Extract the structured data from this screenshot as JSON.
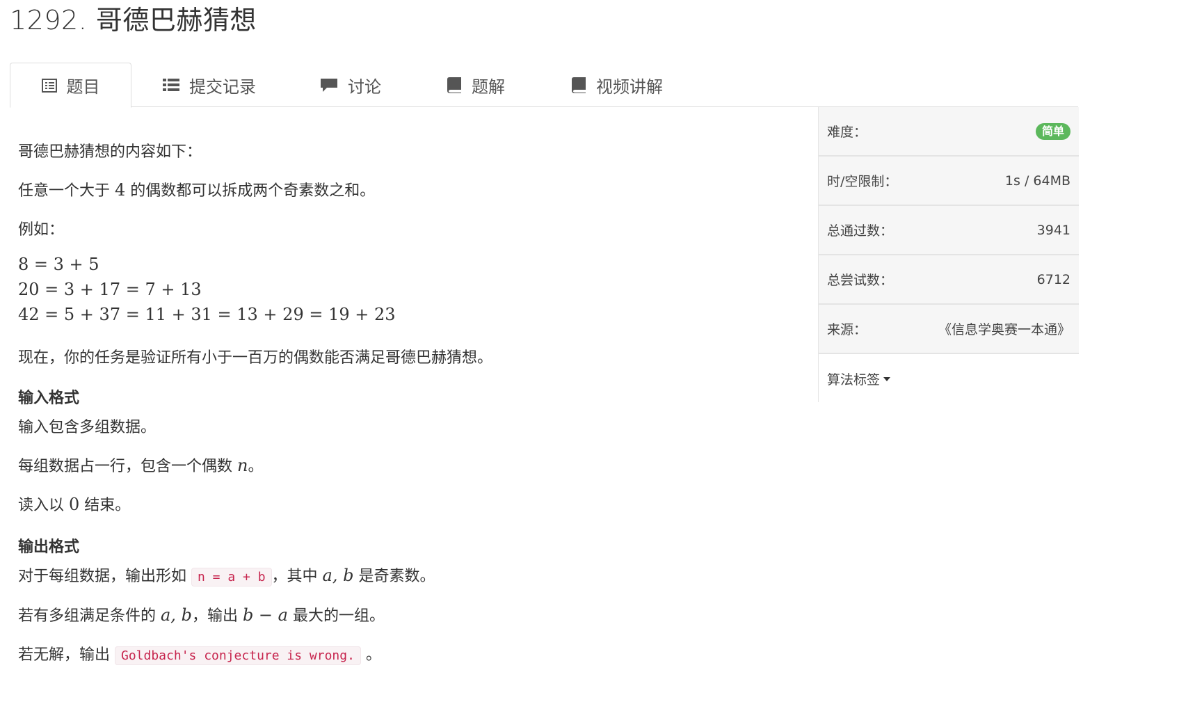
{
  "title": "1292. 哥德巴赫猜想",
  "tabs": [
    {
      "label": "题目",
      "icon": "list-alt-icon",
      "active": true
    },
    {
      "label": "提交记录",
      "icon": "list-icon"
    },
    {
      "label": "讨论",
      "icon": "comment-icon"
    },
    {
      "label": "题解",
      "icon": "book-icon"
    },
    {
      "label": "视频讲解",
      "icon": "book-icon"
    }
  ],
  "content": {
    "intro": "哥德巴赫猜想的内容如下：",
    "statement_pre": "任意一个大于 ",
    "statement_num": "4",
    "statement_post": " 的偶数都可以拆成两个奇素数之和。",
    "example_label": "例如：",
    "equations": [
      "8 = 3 + 5",
      "20 = 3 + 17 = 7 + 13",
      "42 = 5 + 37 = 11 + 31 = 13 + 29 = 19 + 23"
    ],
    "task": "现在，你的任务是验证所有小于一百万的偶数能否满足哥德巴赫猜想。",
    "input_heading": "输入格式",
    "input_lines": {
      "l1": "输入包含多组数据。",
      "l2_pre": "每组数据占一行，包含一个偶数 ",
      "l2_var": "n",
      "l2_post": "。",
      "l3_pre": "读入以 ",
      "l3_num": "0",
      "l3_post": " 结束。"
    },
    "output_heading": "输出格式",
    "output_lines": {
      "l1_pre": "对于每组数据，输出形如 ",
      "l1_code": "n = a + b",
      "l1_mid": "，其中 ",
      "l1_var": "a, b",
      "l1_post": " 是奇素数。",
      "l2_pre": "若有多组满足条件的 ",
      "l2_var": "a, b",
      "l2_mid": "，输出 ",
      "l2_expr": "b − a",
      "l2_post": " 最大的一组。",
      "l3_pre": "若无解，输出 ",
      "l3_code": "Goldbach's conjecture is wrong.",
      "l3_post": " 。"
    }
  },
  "sidebar": {
    "difficulty_label": "难度：",
    "difficulty_value": "简单",
    "limit_label": "时/空限制：",
    "limit_value": "1s / 64MB",
    "passed_label": "总通过数：",
    "passed_value": "3941",
    "attempts_label": "总尝试数：",
    "attempts_value": "6712",
    "source_label": "来源：",
    "source_value": "《信息学奥赛一本通》",
    "tags_label": "算法标签"
  },
  "colors": {
    "badge_green": "#5cb85c",
    "code_red": "#c7254e",
    "code_bg": "#f9f2f4"
  }
}
